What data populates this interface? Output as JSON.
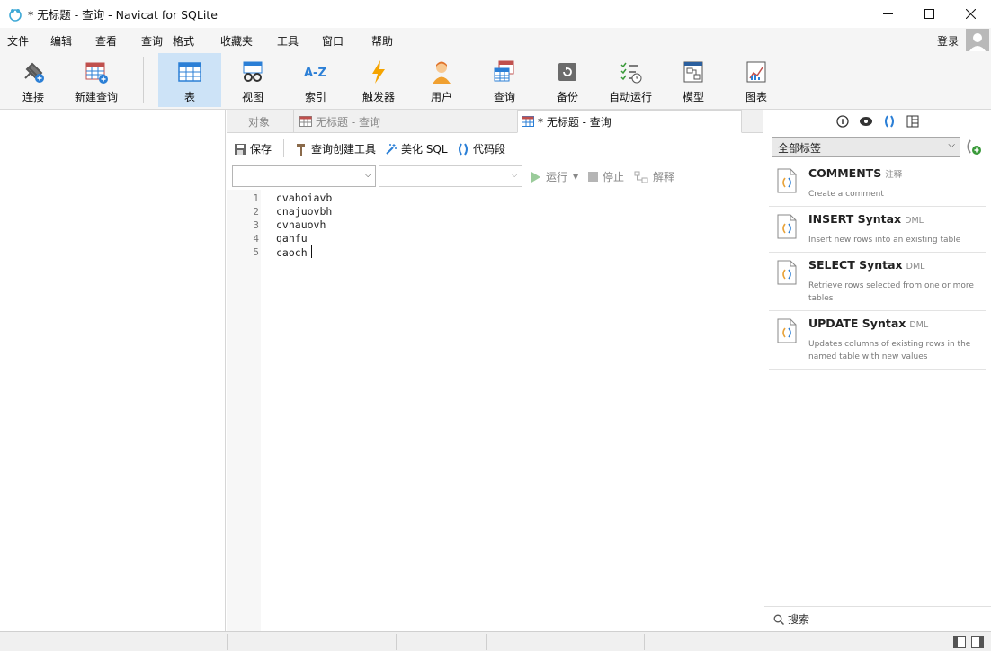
{
  "window": {
    "title": "* 无标题 - 查询 - Navicat for SQLite"
  },
  "menu": {
    "items": [
      "文件",
      "编辑",
      "查看",
      "查询",
      "格式",
      "收藏夹",
      "工具",
      "窗口",
      "帮助"
    ],
    "login": "登录"
  },
  "ribbon": {
    "buttons": [
      "连接",
      "新建查询",
      "表",
      "视图",
      "索引",
      "触发器",
      "用户",
      "查询",
      "备份",
      "自动运行",
      "模型",
      "图表"
    ],
    "active": "表"
  },
  "tabs": {
    "objects": "对象",
    "tab1": "无标题 - 查询",
    "tab2": "* 无标题 - 查询"
  },
  "query_toolbar": {
    "save": "保存",
    "builder": "查询创建工具",
    "beautify": "美化 SQL",
    "snippet": "代码段"
  },
  "run_bar": {
    "run": "运行",
    "stop": "停止",
    "explain": "解释"
  },
  "editor": {
    "line_numbers": [
      "1",
      "2",
      "3",
      "4",
      "5"
    ],
    "lines": [
      "cvahoiavb",
      "cnajuovbh",
      "cvnauovh",
      "qahfu",
      "caoch"
    ]
  },
  "snippets_panel": {
    "filter_value": "全部标签",
    "items": [
      {
        "name": "COMMENTS",
        "tag": "注释",
        "desc": "Create a comment"
      },
      {
        "name": "INSERT Syntax",
        "tag": "DML",
        "desc": "Insert new rows into an existing table"
      },
      {
        "name": "SELECT Syntax",
        "tag": "DML",
        "desc": "Retrieve rows selected from one or more tables"
      },
      {
        "name": "UPDATE Syntax",
        "tag": "DML",
        "desc": "Updates columns of existing rows in the named table with new values"
      }
    ],
    "search_placeholder": "搜索"
  },
  "colors": {
    "active_tab_bg": "#cde3f7",
    "accent_blue": "#2b7fd6",
    "snippet_icon_orange": "#e8a33a"
  }
}
